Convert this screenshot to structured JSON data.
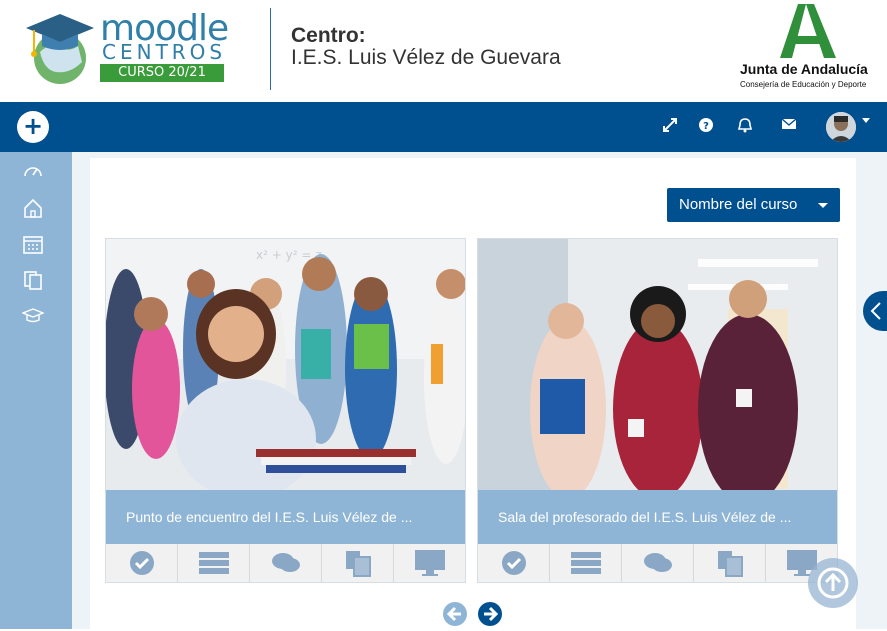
{
  "header": {
    "logo": {
      "word": "moodle",
      "sub": "CENTROS",
      "course_year": "CURSO 20/21"
    },
    "centro_label": "Centro:",
    "centro_name": "I.E.S. Luis Vélez de Guevara",
    "junta": {
      "name": "Junta de Andalucía",
      "sub": "Consejería de Educación y Deporte"
    }
  },
  "navbar": {
    "add_symbol": "+",
    "icons": [
      "fullscreen-icon",
      "help-icon",
      "bell-icon",
      "envelope-icon"
    ],
    "avatar": "user-avatar"
  },
  "sidebar": {
    "items": [
      "dashboard-icon",
      "home-icon",
      "calendar-icon",
      "files-icon",
      "graduation-cap-icon"
    ]
  },
  "main": {
    "sort_button_label": "Nombre del curso",
    "courses": [
      {
        "title": "Punto de encuentro del I.E.S. Luis Vélez de ..."
      },
      {
        "title": "Sala del profesorado del I.E.S. Luis Vélez de ..."
      }
    ],
    "card_actions": [
      "check-icon",
      "list-icon",
      "comments-icon",
      "copy-icon",
      "desktop-icon"
    ]
  },
  "colors": {
    "nav_blue": "#004f8f",
    "sidebar_blue": "#8fb5d6",
    "card_title_blue": "#8fb5d6",
    "logo_green": "#3a9b3a",
    "logo_blue": "#2f7fa8"
  }
}
